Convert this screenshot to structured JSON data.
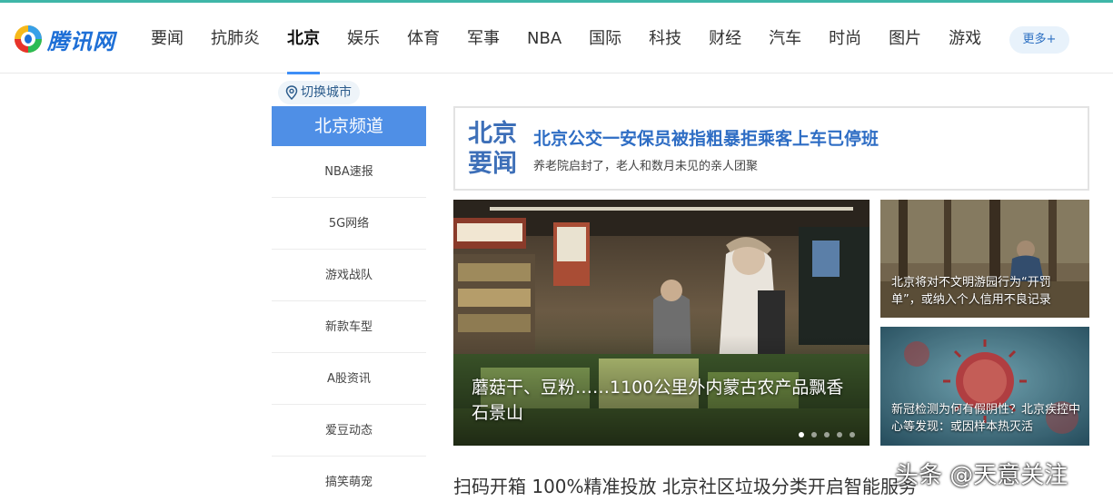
{
  "logo": {
    "text": "腾讯网"
  },
  "nav": {
    "items": [
      "要闻",
      "抗肺炎",
      "北京",
      "娱乐",
      "体育",
      "军事",
      "NBA",
      "国际",
      "科技",
      "财经",
      "汽车",
      "时尚",
      "图片",
      "游戏"
    ],
    "active": "北京",
    "more_label": "更多+"
  },
  "sidebar": {
    "city_switch": "切换城市",
    "channel_title": "北京频道",
    "items": [
      "NBA速报",
      "5G网络",
      "游戏战队",
      "新款车型",
      "A股资讯",
      "爱豆动态",
      "搞笑萌宠"
    ]
  },
  "headline": {
    "tag_line1": "北京",
    "tag_line2": "要闻",
    "title": "北京公交一安保员被指粗暴拒乘客上车已停班",
    "subtitle": "养老院启封了，老人和数月未见的亲人团聚"
  },
  "carousel": {
    "caption": "蘑菇干、豆粉……1100公里外内蒙古农产品飘香石景山",
    "dot_count": 5,
    "active_dot": 0
  },
  "side_news": [
    {
      "caption": "北京将对不文明游园行为“开罚单”，或纳入个人信用不良记录"
    },
    {
      "caption": "新冠检测为何有假阴性？北京疾控中心等发现：或因样本热灭活"
    }
  ],
  "bottom_news": "扫码开箱 100%精准投放 北京社区垃圾分类开启智能服务",
  "watermark": "头条 @天意关注",
  "colors": {
    "accent": "#3e8ef7",
    "channel_bg": "#4f8fe6",
    "headline_blue": "#2e6dc4"
  }
}
